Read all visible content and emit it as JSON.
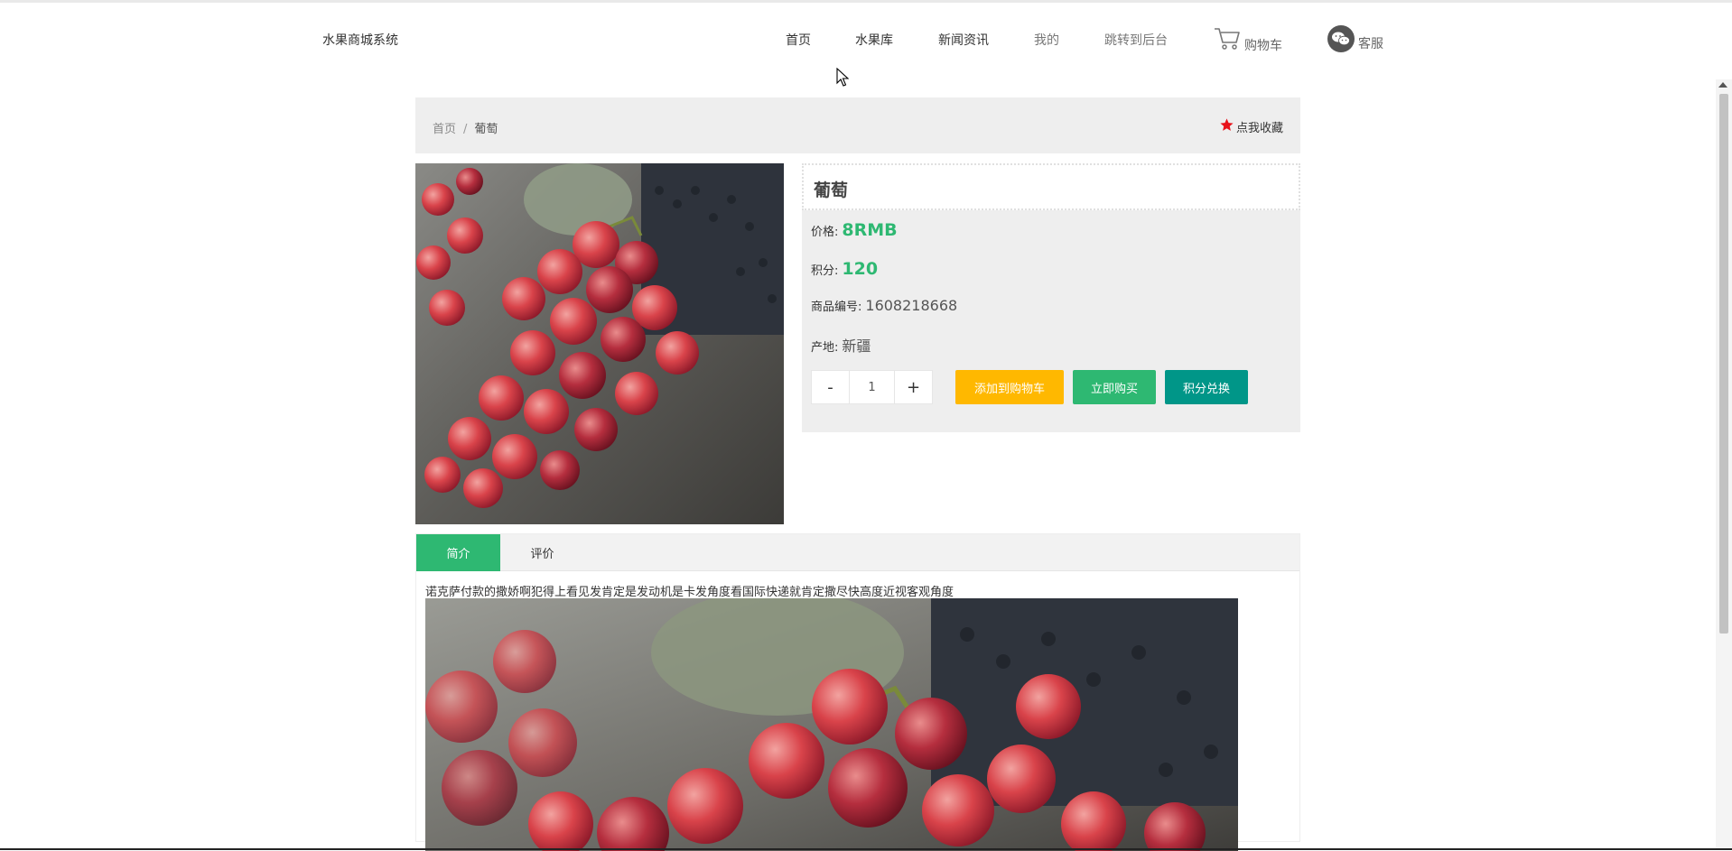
{
  "header": {
    "logo": "水果商城系统",
    "nav": {
      "home": "首页",
      "fruits": "水果库",
      "news": "新闻资讯",
      "mine": "我的",
      "admin": "跳转到后台",
      "cart": "购物车",
      "service": "客服"
    },
    "icons": {
      "cart": "shopping-cart-icon",
      "service": "wechat-icon"
    }
  },
  "breadcrumb": {
    "home": "首页",
    "separator": "/",
    "current": "葡萄"
  },
  "favorite": {
    "icon": "star-icon",
    "label": "点我收藏",
    "star_color": "#e8121a"
  },
  "product": {
    "name": "葡萄",
    "price_label": "价格:",
    "price": "8RMB",
    "points_label": "积分:",
    "points": "120",
    "sku_label": "商品编号:",
    "sku": "1608218668",
    "origin_label": "产地:",
    "origin": "新疆",
    "quantity": "1",
    "minus": "-",
    "plus": "+",
    "buttons": {
      "add_to_cart": "添加到购物车",
      "buy_now": "立即购买",
      "redeem": "积分兑换"
    }
  },
  "tabs": {
    "intro": "简介",
    "reviews": "评价"
  },
  "description": "诺克萨付款的撒娇啊犯得上看见发肯定是发动机是卡发角度看国际快递就肯定撒尽快高度近视客观角度",
  "colors": {
    "accent_green": "#2eb872",
    "add_cart_yellow": "#ffb800",
    "redeem_teal": "#009688",
    "panel_gray": "#eeeeee"
  }
}
